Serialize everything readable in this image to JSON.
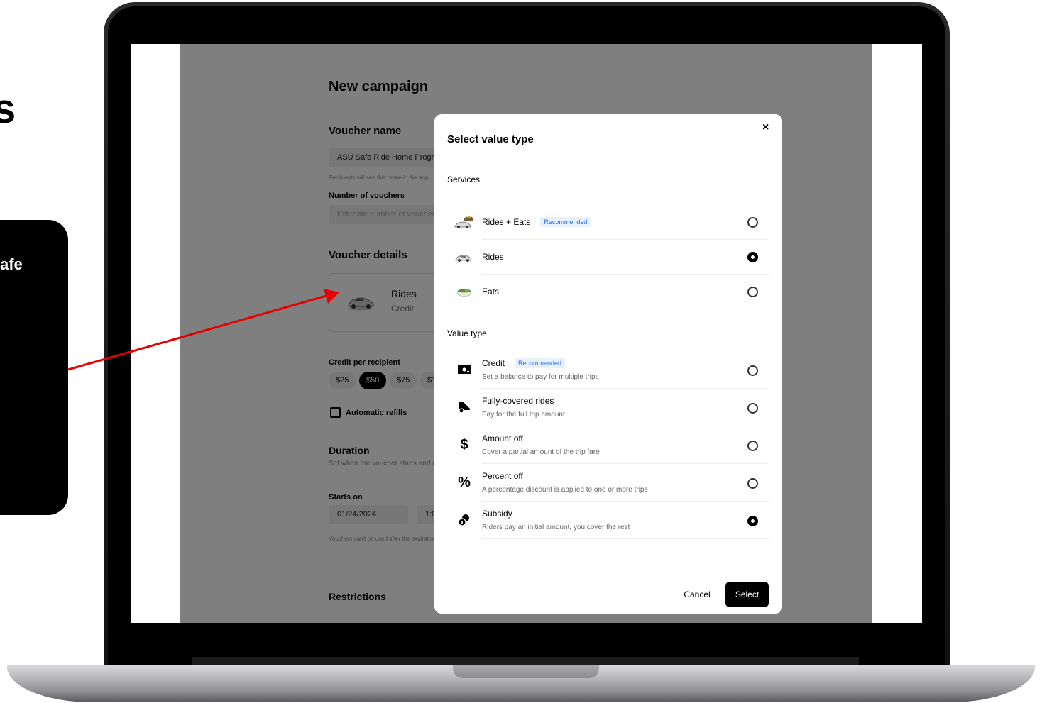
{
  "left_panel": {
    "fragment_large": "s",
    "card_text": "afe"
  },
  "page": {
    "title": "New campaign",
    "voucher_name_heading": "Voucher name",
    "voucher_name_value": "ASU Safe Ride Home Program",
    "voucher_name_hint": "Recipients will see this name in the app",
    "number_label": "Number of vouchers",
    "number_placeholder": "Estimate number of vouchers",
    "details_heading": "Voucher details",
    "card_title": "Rides",
    "card_subtitle": "Credit",
    "credit_label": "Credit per recipient",
    "credit_options": [
      "$25",
      "$50",
      "$75",
      "$1"
    ],
    "credit_selected": "$50",
    "auto_refill_label": "Automatic refills",
    "duration_heading": "Duration",
    "duration_hint": "Set when the voucher starts and ends",
    "starts_label": "Starts on",
    "start_date": "01/24/2024",
    "start_time": "1:0",
    "expiry_hint": "Vouchers can't be used after the expiration date",
    "restrictions_heading": "Restrictions"
  },
  "modal": {
    "title": "Select value type",
    "close_label": "×",
    "services_heading": "Services",
    "services": [
      {
        "label": "Rides + Eats",
        "badge": "Recommended",
        "icon": "car-and-bowl-icon",
        "selected": false
      },
      {
        "label": "Rides",
        "badge": "",
        "icon": "car-icon",
        "selected": true
      },
      {
        "label": "Eats",
        "badge": "",
        "icon": "bowl-icon",
        "selected": false
      }
    ],
    "value_type_heading": "Value type",
    "value_types": [
      {
        "label": "Credit",
        "badge": "Recommended",
        "desc": "Set a balance to pay for multiple trips",
        "icon": "cash-icon",
        "selected": false
      },
      {
        "label": "Fully-covered rides",
        "badge": "",
        "desc": "Pay for the full trip amount",
        "icon": "covered-ride-icon",
        "selected": false
      },
      {
        "label": "Amount off",
        "badge": "",
        "desc": "Cover a partial amount of the trip fare",
        "icon": "dollar-icon",
        "selected": false
      },
      {
        "label": "Percent off",
        "badge": "",
        "desc": "A percentage discount is applied to one or more trips",
        "icon": "percent-icon",
        "selected": false
      },
      {
        "label": "Subsidy",
        "badge": "",
        "desc": "Riders pay an initial amount, you cover the rest",
        "icon": "coins-icon",
        "selected": true
      }
    ],
    "cancel_label": "Cancel",
    "select_label": "Select"
  },
  "colors": {
    "accent_badge_text": "#276ef1",
    "accent_badge_bg": "#e7f0fd",
    "arrow": "#e60000",
    "primary": "#000000"
  }
}
